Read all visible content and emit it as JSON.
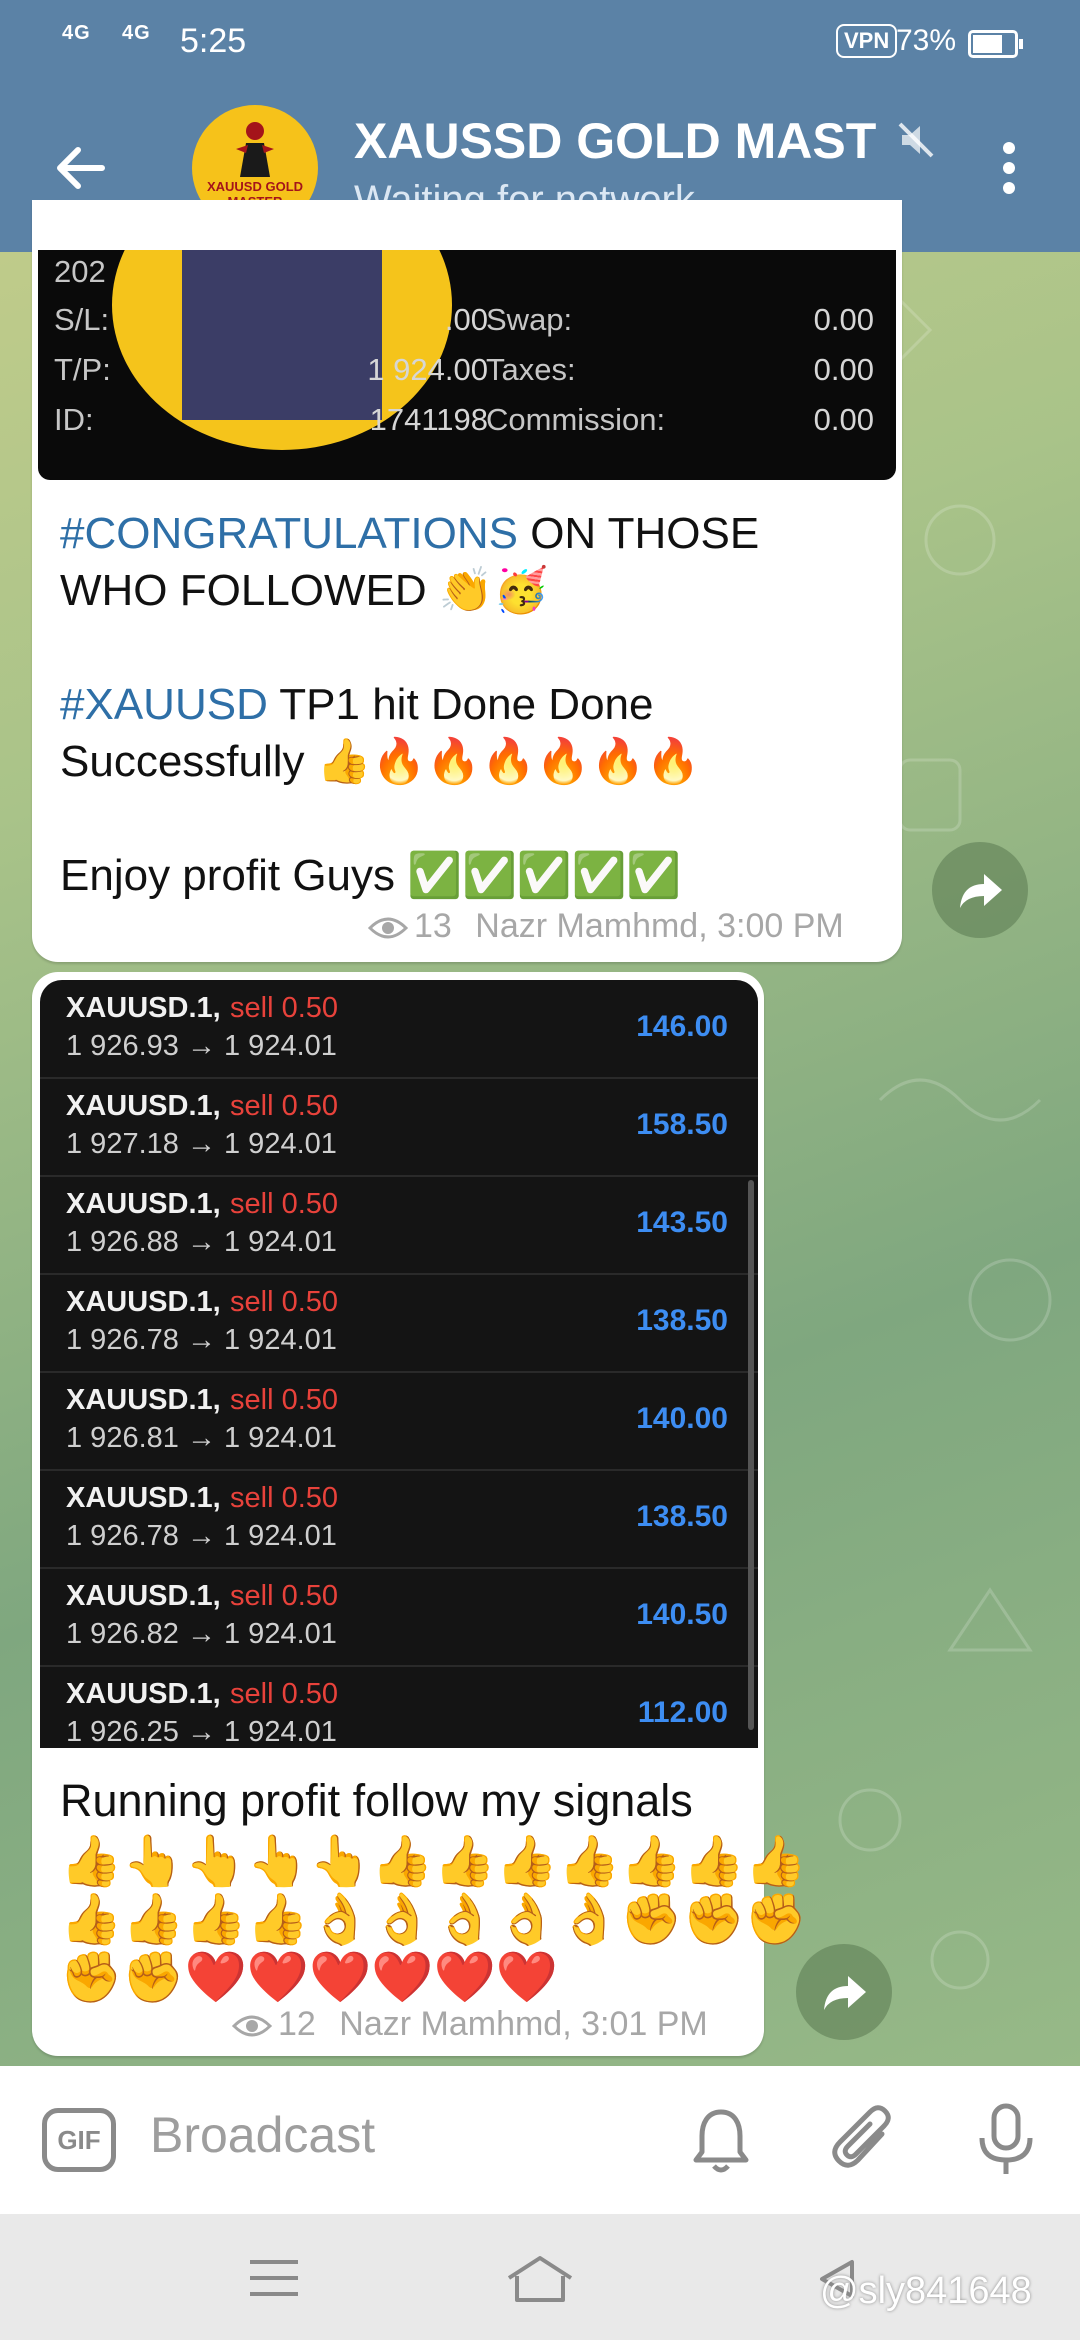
{
  "status_bar": {
    "net1": "4G",
    "net2": "4G",
    "time": "5:25",
    "vpn": "VPN",
    "battery": "73%",
    "battery_level": 0.73
  },
  "header": {
    "title": "XAUSSD GOLD MAST",
    "subtitle": "Waiting for network...",
    "avatar_text": "XAUUSD GOLD MASTER"
  },
  "trade_card": {
    "partial_label": "202",
    "rows": [
      {
        "label": "S/L:",
        "value": ".00",
        "label2": "Swap:",
        "value2": "0.00"
      },
      {
        "label": "T/P:",
        "value": "1 924.00",
        "label2": "Taxes:",
        "value2": "0.00"
      },
      {
        "label": "ID:",
        "value": "1741198",
        "label2": "Commission:",
        "value2": "0.00"
      }
    ]
  },
  "message1": {
    "tag1": "#CONGRATULATIONS",
    "line1_rest": " ON THOSE",
    "line2": "WHO FOLLOWED  👏🥳",
    "tag2": "#XAUUSD",
    "line3_rest": "  TP1 hit  Done  Done",
    "line4": "Successfully 👍🔥🔥🔥🔥🔥🔥",
    "line5": "Enjoy profit Guys ✅✅✅✅✅",
    "views": "13",
    "author_time": "Nazr Mamhmd, 3:00 PM"
  },
  "trades": [
    {
      "symbol": "XAUUSD.1,",
      "side": "sell 0.50",
      "prices": "1 926.93 → 1 924.01",
      "profit": "146.00"
    },
    {
      "symbol": "XAUUSD.1,",
      "side": "sell 0.50",
      "prices": "1 927.18 → 1 924.01",
      "profit": "158.50"
    },
    {
      "symbol": "XAUUSD.1,",
      "side": "sell 0.50",
      "prices": "1 926.88 → 1 924.01",
      "profit": "143.50"
    },
    {
      "symbol": "XAUUSD.1,",
      "side": "sell 0.50",
      "prices": "1 926.78 → 1 924.01",
      "profit": "138.50"
    },
    {
      "symbol": "XAUUSD.1,",
      "side": "sell 0.50",
      "prices": "1 926.81 → 1 924.01",
      "profit": "140.00"
    },
    {
      "symbol": "XAUUSD.1,",
      "side": "sell 0.50",
      "prices": "1 926.78 → 1 924.01",
      "profit": "138.50"
    },
    {
      "symbol": "XAUUSD.1,",
      "side": "sell 0.50",
      "prices": "1 926.82 → 1 924.01",
      "profit": "140.50"
    },
    {
      "symbol": "XAUUSD.1,",
      "side": "sell 0.50",
      "prices": "1 926.25 → 1 924.01",
      "profit": "112.00"
    }
  ],
  "message2": {
    "text": "Running profit follow my signals",
    "emoji1": "👍👆👆👆👆👍👍👍👍👍👍👍",
    "emoji2": "👍👍👍👍👌👌👌👌👌✊✊✊",
    "emoji3": "✊✊❤️❤️❤️❤️❤️❤️",
    "views": "12",
    "author_time": "Nazr Mamhmd, 3:01 PM"
  },
  "input": {
    "gif": "GIF",
    "placeholder": "Broadcast"
  },
  "watermark": "@sly841648"
}
